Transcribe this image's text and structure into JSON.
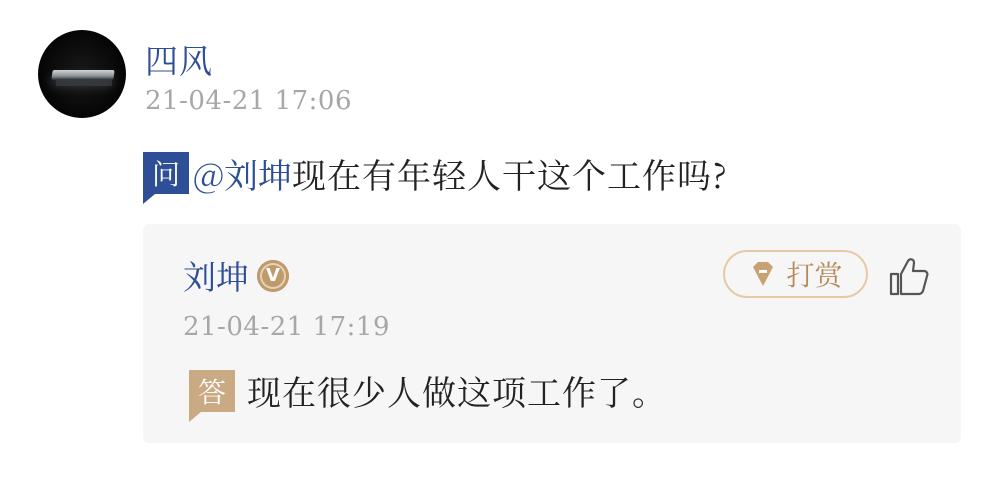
{
  "asker": {
    "name": "四风",
    "time": "21-04-21 17:06"
  },
  "question": {
    "badge": "问",
    "mention": "@刘坤",
    "text": "现在有年轻人干这个工作吗?"
  },
  "answer": {
    "author": "刘坤",
    "verified_badge": "V",
    "time": "21-04-21 17:19",
    "badge": "答",
    "text": "现在很少人做这项工作了。",
    "reward_label": "打赏",
    "icons": {
      "verified": "verified-v-icon",
      "reward": "diamond-reward-icon",
      "like": "thumbs-up-icon"
    }
  },
  "colors": {
    "accent_blue": "#2e4f95",
    "gold": "#c9aa82",
    "timestamp_gray": "#a7a7a7",
    "card_bg": "#f6f6f6"
  }
}
